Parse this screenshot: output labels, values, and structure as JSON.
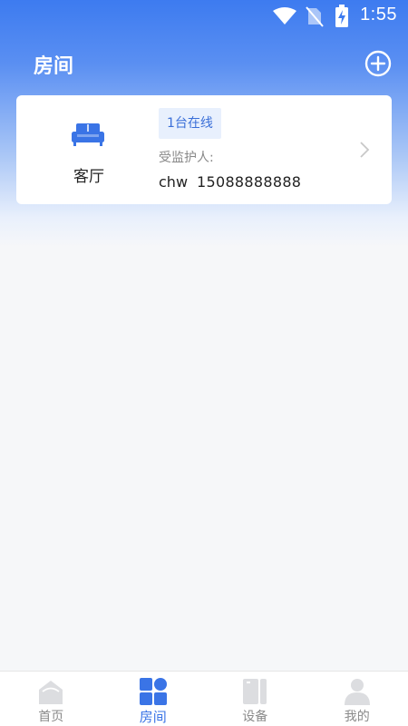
{
  "status_bar": {
    "time": "1:55",
    "icons": [
      "wifi-icon",
      "no-sim-icon",
      "battery-charging-icon"
    ]
  },
  "header": {
    "title": "房间",
    "add_icon": "plus-circle-icon"
  },
  "room_card": {
    "icon": "sofa-icon",
    "room_name": "客厅",
    "online_badge": "1台在线",
    "monitor_label": "受监护人:",
    "monitor_name": "chw",
    "monitor_phone": "15088888888"
  },
  "bottom_nav": {
    "items": [
      {
        "label": "首页",
        "icon": "home-icon",
        "active": false
      },
      {
        "label": "房间",
        "icon": "rooms-grid-icon",
        "active": true
      },
      {
        "label": "设备",
        "icon": "device-icon",
        "active": false
      },
      {
        "label": "我的",
        "icon": "person-icon",
        "active": false
      }
    ]
  },
  "colors": {
    "accent": "#3a74e6",
    "header_gradient_top": "#3d7bf0",
    "badge_bg": "#e8f0fd",
    "inactive_icon": "#dcdde0"
  }
}
